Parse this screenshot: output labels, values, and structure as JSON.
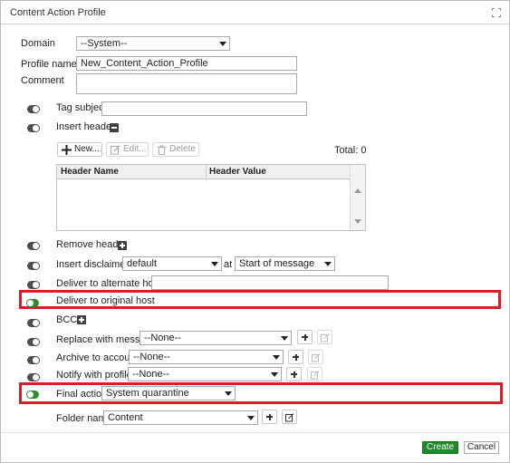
{
  "dialog": {
    "title": "Content Action Profile"
  },
  "form": {
    "domain_label": "Domain",
    "domain_value": "--System--",
    "profile_name_label": "Profile name",
    "profile_name_value": "New_Content_Action_Profile",
    "comment_label": "Comment",
    "comment_value": ""
  },
  "options": {
    "tag_subject": {
      "label": "Tag subject",
      "enabled": false,
      "value": ""
    },
    "insert_header": {
      "label": "Insert header",
      "enabled": false
    },
    "remove_header": {
      "label": "Remove header",
      "enabled": false
    },
    "insert_disclaimer": {
      "label": "Insert disclaimer",
      "enabled": false,
      "value": "default",
      "at_label": "at",
      "position": "Start of message"
    },
    "deliver_alternate": {
      "label": "Deliver to alternate host",
      "enabled": false,
      "value": ""
    },
    "deliver_original": {
      "label": "Deliver to original host",
      "enabled": true
    },
    "bcc": {
      "label": "BCC",
      "enabled": false
    },
    "replace_message": {
      "label": "Replace with message",
      "enabled": false,
      "value": "--None--"
    },
    "archive_account": {
      "label": "Archive to account",
      "enabled": false,
      "value": "--None--"
    },
    "notify_profile": {
      "label": "Notify with profile",
      "enabled": false,
      "value": "--None--"
    },
    "final_action": {
      "label": "Final action",
      "enabled": true,
      "value": "System quarantine"
    },
    "folder_name": {
      "label": "Folder name",
      "value": "Content"
    }
  },
  "header_table": {
    "new_label": "New...",
    "edit_label": "Edit...",
    "delete_label": "Delete",
    "total_label": "Total: 0",
    "columns": [
      "Header Name",
      "Header Value"
    ],
    "rows": []
  },
  "footer": {
    "create_label": "Create",
    "cancel_label": "Cancel"
  },
  "colors": {
    "highlight": "#dd1c2a",
    "toggle_on": "#2e8b2e",
    "create_button": "#1f8a2b"
  }
}
